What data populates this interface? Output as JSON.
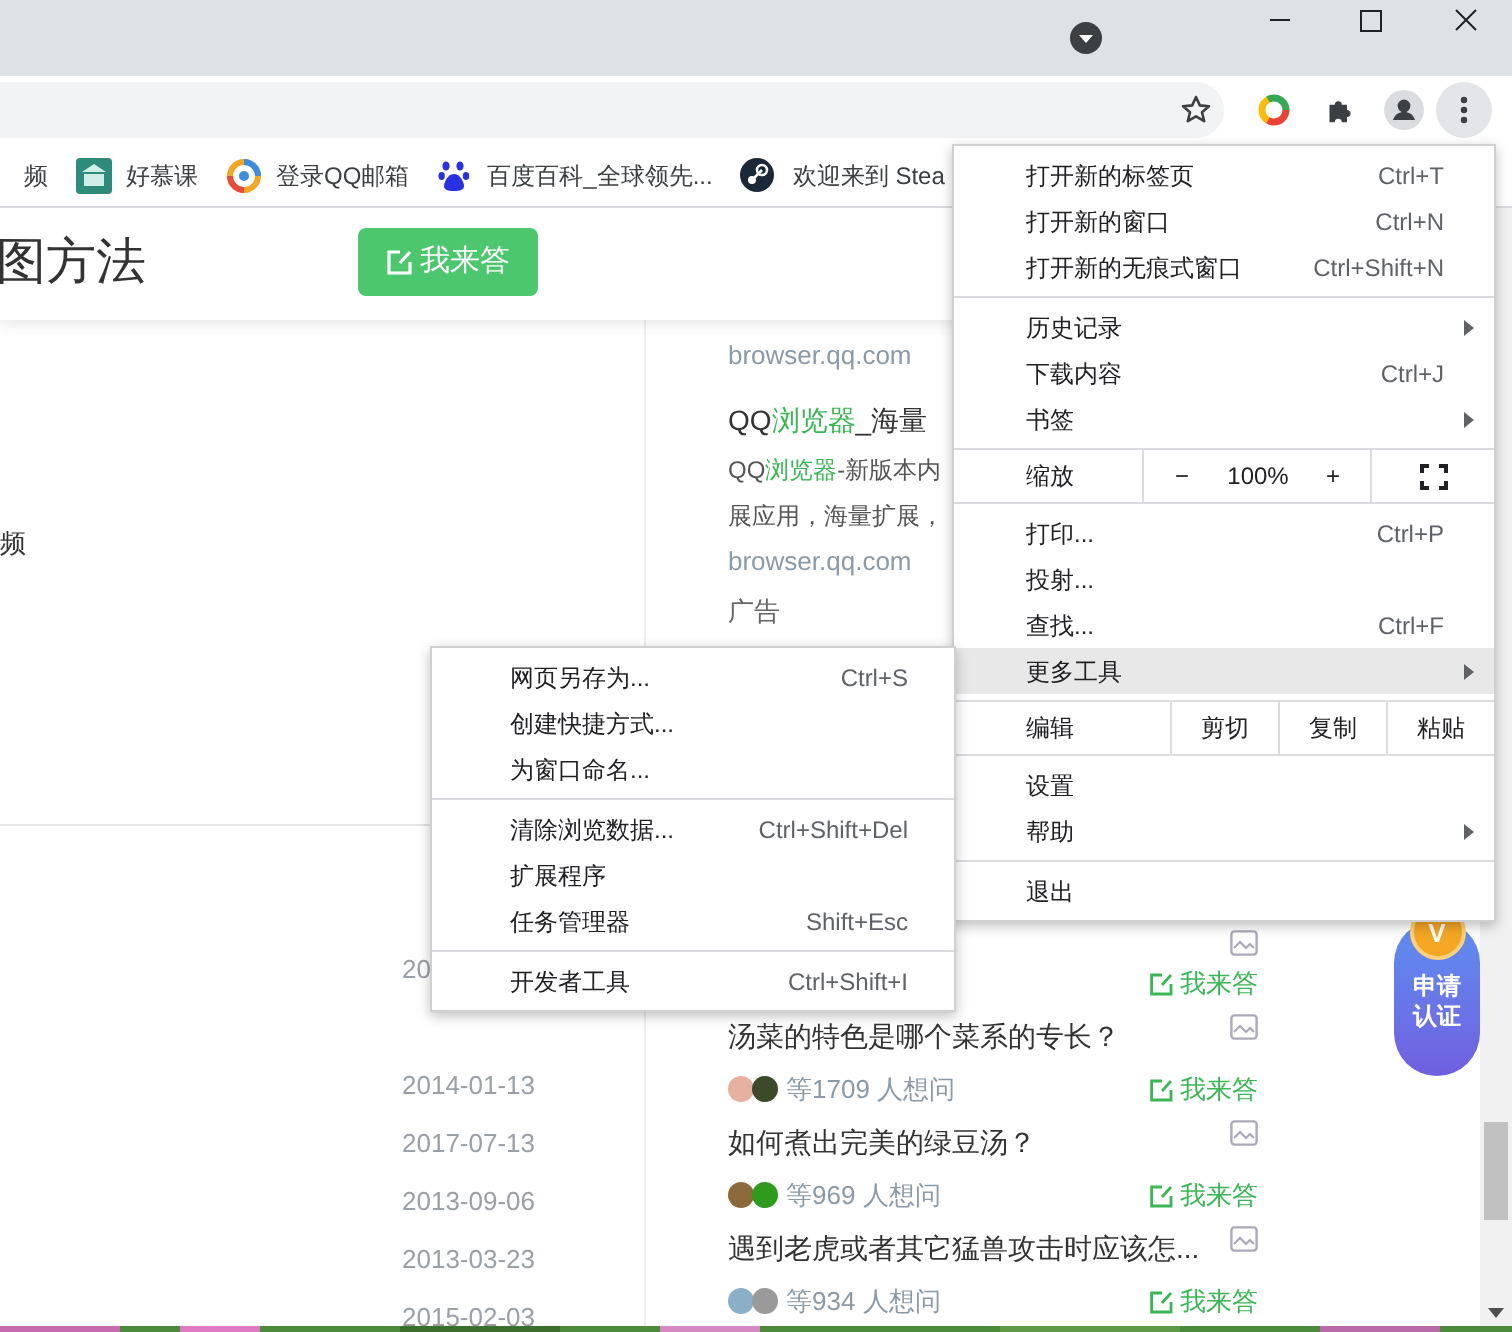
{
  "bookmarks": [
    {
      "label": "频"
    },
    {
      "label": "好慕课"
    },
    {
      "label": "登录QQ邮箱"
    },
    {
      "label": "百度百科_全球领先..."
    },
    {
      "label": "欢迎来到 Stea"
    }
  ],
  "page": {
    "title": "图方法",
    "answer_button": "我来答",
    "left_fragment": "频",
    "dates": [
      "20",
      "2014-01-13",
      "2017-07-13",
      "2013-09-06",
      "2013-03-23",
      "2015-02-03"
    ],
    "ad": {
      "source_top": "browser.qq.com",
      "title_parts": [
        {
          "text": "QQ",
          "highlight": false
        },
        {
          "text": "浏览器",
          "highlight": true
        },
        {
          "text": "_海量",
          "highlight": false
        }
      ],
      "desc_lines": [
        [
          {
            "text": "QQ",
            "highlight": false
          },
          {
            "text": "浏览器",
            "highlight": true
          },
          {
            "text": "-新版本内",
            "highlight": false
          }
        ],
        [
          {
            "text": "展应用，海量扩展，",
            "highlight": false
          }
        ]
      ],
      "source_bottom": "browser.qq.com",
      "label": "广告"
    },
    "questions": [
      {
        "answer": "我来答"
      },
      {
        "title": "汤菜的特色是哪个菜系的专长？",
        "askers": "等1709 人想问",
        "answer": "我来答"
      },
      {
        "title": "如何煮出完美的绿豆汤？",
        "askers": "等969 人想问",
        "answer": "我来答"
      },
      {
        "title": "遇到老虎或者其它猛兽攻击时应该怎...",
        "askers": "等934 人想问",
        "answer": "我来答"
      }
    ],
    "badge": {
      "mark": "V",
      "label": "申请认证"
    }
  },
  "menu": {
    "groups": [
      [
        {
          "kind": "item",
          "label": "打开新的标签页",
          "shortcut": "Ctrl+T",
          "has_submenu": false,
          "selected": false
        },
        {
          "kind": "item",
          "label": "打开新的窗口",
          "shortcut": "Ctrl+N",
          "has_submenu": false,
          "selected": false
        },
        {
          "kind": "item",
          "label": "打开新的无痕式窗口",
          "shortcut": "Ctrl+Shift+N",
          "has_submenu": false,
          "selected": false
        }
      ],
      [
        {
          "kind": "item",
          "label": "历史记录",
          "has_submenu": true,
          "selected": false
        },
        {
          "kind": "item",
          "label": "下载内容",
          "shortcut": "Ctrl+J",
          "has_submenu": false,
          "selected": false
        },
        {
          "kind": "item",
          "label": "书签",
          "has_submenu": true,
          "selected": false
        }
      ],
      [
        {
          "kind": "zoom",
          "label": "缩放",
          "minus": "−",
          "value": "100%",
          "plus": "+"
        }
      ],
      [
        {
          "kind": "item",
          "label": "打印...",
          "shortcut": "Ctrl+P",
          "has_submenu": false,
          "selected": false
        },
        {
          "kind": "item",
          "label": "投射...",
          "has_submenu": false,
          "selected": false
        },
        {
          "kind": "item",
          "label": "查找...",
          "shortcut": "Ctrl+F",
          "has_submenu": false,
          "selected": false
        },
        {
          "kind": "item",
          "label": "更多工具",
          "has_submenu": true,
          "selected": true
        }
      ],
      [
        {
          "kind": "edit",
          "label": "编辑",
          "buttons": [
            "剪切",
            "复制",
            "粘贴"
          ]
        }
      ],
      [
        {
          "kind": "item",
          "label": "设置",
          "has_submenu": false,
          "selected": false
        },
        {
          "kind": "item",
          "label": "帮助",
          "has_submenu": true,
          "selected": false
        }
      ],
      [
        {
          "kind": "item",
          "label": "退出",
          "has_submenu": false,
          "selected": false
        }
      ]
    ]
  },
  "submenu": {
    "groups": [
      [
        {
          "label": "网页另存为...",
          "shortcut": "Ctrl+S"
        },
        {
          "label": "创建快捷方式..."
        },
        {
          "label": "为窗口命名..."
        }
      ],
      [
        {
          "label": "清除浏览数据...",
          "shortcut": "Ctrl+Shift+Del"
        },
        {
          "label": "扩展程序"
        },
        {
          "label": "任务管理器",
          "shortcut": "Shift+Esc"
        }
      ],
      [
        {
          "label": "开发者工具",
          "shortcut": "Ctrl+Shift+I"
        }
      ]
    ]
  }
}
